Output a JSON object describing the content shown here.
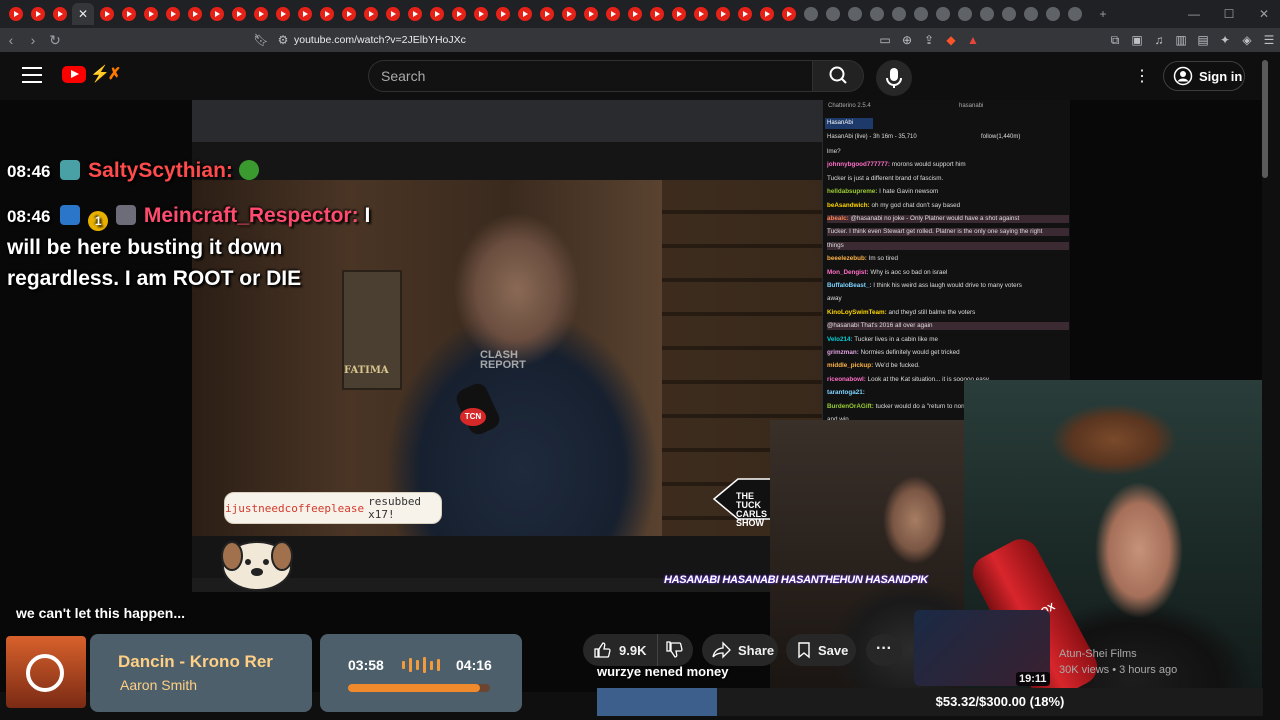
{
  "browser": {
    "url": "youtube.com/watch?v=2JElbYHoJXc",
    "tab_close": "✕",
    "new_tab": "+",
    "window_minimize": "—",
    "window_maximize": "☐",
    "window_close": "✕"
  },
  "header": {
    "search_placeholder": "Search",
    "signin_label": "Sign in"
  },
  "chat_overlay": {
    "messages": [
      {
        "time": "08:46",
        "user": "SaltyScythian:",
        "text": ""
      },
      {
        "time": "08:46",
        "user": "Meincraft_Respector:",
        "text_line1": "I",
        "text_line2": "will be here busting it down",
        "text_line3": "regardless. I am ROOT or DIE"
      }
    ],
    "coin_badge": "1"
  },
  "inner_video": {
    "fatima": "FATIMA",
    "clash_logo_line1": "CLASH",
    "clash_logo_line2": "REPORT",
    "tcn": "TCN",
    "tucker_line1": "THE",
    "tucker_line2": "TUCK",
    "tucker_line3": "CARLS",
    "tucker_line4": "SHOW"
  },
  "sub_alert": {
    "user": "ijustneedcoffeeplease",
    "action": "resubbed x17!"
  },
  "socials": "HASANABI HASANABI HASANTHEHUN HASANDPIK",
  "chatterino": {
    "title": "Chatterino 2.5.4",
    "channel_user": "hasanabi",
    "tab": "HasanAbi",
    "status": "HasanAbi (live) - 3h 16m - 35,710",
    "followers": "follow(1,440m)",
    "lines": [
      {
        "user": "",
        "text": "lme?"
      },
      {
        "user": "johnnybgood777777:",
        "text": "morons would support him"
      },
      {
        "user": "",
        "text": "Tucker is just a different brand of fascism."
      },
      {
        "user": "helldabsupreme:",
        "text": "I hate Gavin newsom"
      },
      {
        "user": "beAsandwich:",
        "text": "oh my god chat don't say based"
      },
      {
        "user": "abealc:",
        "text": "@hasanabi no joke - Only Platner would have a shot against"
      },
      {
        "user": "",
        "text": "Tucker. I think even Stewart get rolled. Platner is the only one saying the right"
      },
      {
        "user": "",
        "text": "things"
      },
      {
        "user": "beeelezebub:",
        "text": "Im so tired"
      },
      {
        "user": "Mon_Dengist:",
        "text": "Why is aoc so bad on israel"
      },
      {
        "user": "BuffaloBeast_:",
        "text": "I think his weird ass laugh would drive to many voters"
      },
      {
        "user": "",
        "text": "away"
      },
      {
        "user": "KinoLoySwimTeam:",
        "text": "and theyd still balme the voters"
      },
      {
        "user": "",
        "text": "@hasanabi That's 2016 all over again"
      },
      {
        "user": "Velo214:",
        "text": "Tucker lives in a cabin like me"
      },
      {
        "user": "grimzman:",
        "text": "Normies definitely would get tricked"
      },
      {
        "user": "middle_pickup:",
        "text": "We'd be fucked."
      },
      {
        "user": "riceonabowl:",
        "text": "Look at the Kat situation... it is sooooo easy"
      },
      {
        "user": "tarantoga21:",
        "text": ""
      },
      {
        "user": "BurdenOrAGift:",
        "text": "tucker would do a \"return to normalcy\" type thing"
      },
      {
        "user": "",
        "text": "and win"
      }
    ]
  },
  "webcam": {
    "can_label": "OR\nSOX"
  },
  "caption": "we can't let this happen...",
  "music": {
    "title": "Dancin - Krono Rer",
    "artist": "Aaron Smith",
    "time_current": "03:58",
    "time_total": "04:16",
    "progress_fraction": 0.93
  },
  "actions": {
    "like_count": "9.9K",
    "share": "Share",
    "save": "Save",
    "more": "···"
  },
  "donation": {
    "text": "wurzye nened money",
    "goal_text": "$53.32/$300.00 (18%)",
    "goal_fraction": 0.18
  },
  "recommendation": {
    "duration": "19:11",
    "channel": "Atun-Shei Films",
    "meta": "30K views • 3 hours ago"
  },
  "colors": {
    "youtube_red": "#ff0000",
    "chat_username_red": "#ff4b4b",
    "music_accent": "#f08a2d",
    "goal_fill": "#3d5f8c"
  }
}
